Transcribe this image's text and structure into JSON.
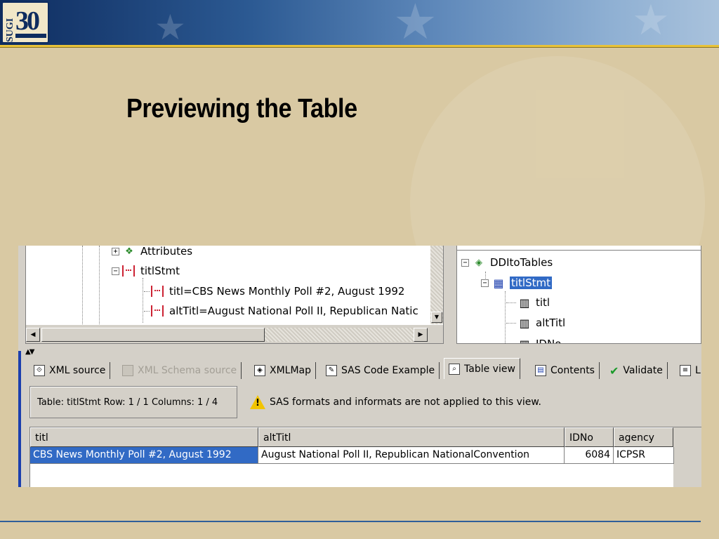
{
  "slide": {
    "title": "Previewing the Table",
    "logo": {
      "vertical": "SUGI",
      "number": "30"
    }
  },
  "tree_left": {
    "nodes": [
      {
        "label": "Attributes",
        "expander": "+",
        "icon": "attributes-icon"
      },
      {
        "label": "titlStmt",
        "expander": "−",
        "icon": "element-icon"
      },
      {
        "label": "titl=CBS News Monthly Poll #2, August 1992",
        "icon": "element-icon"
      },
      {
        "label": "altTitl=August National Poll II, Republican Natic",
        "icon": "element-icon"
      }
    ]
  },
  "tree_right": {
    "nodes": [
      {
        "label": "DDItoTables",
        "expander": "−",
        "icon": "xmlmap-icon"
      },
      {
        "label": "titlStmt",
        "expander": "−",
        "icon": "table-icon",
        "selected": true
      },
      {
        "label": "titl",
        "icon": "column-icon"
      },
      {
        "label": "altTitl",
        "icon": "column-icon"
      },
      {
        "label": "IDNo",
        "icon": "column-icon"
      }
    ]
  },
  "tabs": [
    {
      "label": "XML source",
      "icon": "xml-source-icon"
    },
    {
      "label": "XML Schema source",
      "icon": "schema-icon",
      "disabled": true
    },
    {
      "label": "XMLMap",
      "icon": "xmlmap-icon"
    },
    {
      "label": "SAS Code Example",
      "icon": "sas-code-icon"
    },
    {
      "label": "Table view",
      "icon": "table-view-icon",
      "active": true
    },
    {
      "label": "Contents",
      "icon": "contents-icon"
    },
    {
      "label": "Validate",
      "icon": "check-icon"
    },
    {
      "label": "L",
      "icon": "log-icon"
    }
  ],
  "info": {
    "status": "Table: titlStmt  Row: 1 / 1  Columns: 1 / 4",
    "warning": "SAS formats and informats are not applied to this view."
  },
  "table": {
    "columns": [
      "titl",
      "altTitl",
      "IDNo",
      "agency"
    ],
    "rows": [
      [
        "CBS News Monthly Poll #2, August 1992",
        "August National Poll II, Republican NationalConvention",
        "6084",
        "ICPSR"
      ]
    ]
  },
  "colors": {
    "selection": "#316ac5",
    "header_gold": "#e8c33a",
    "header_blue": "#0e2c5f",
    "slide_bg": "#d9c9a3"
  }
}
